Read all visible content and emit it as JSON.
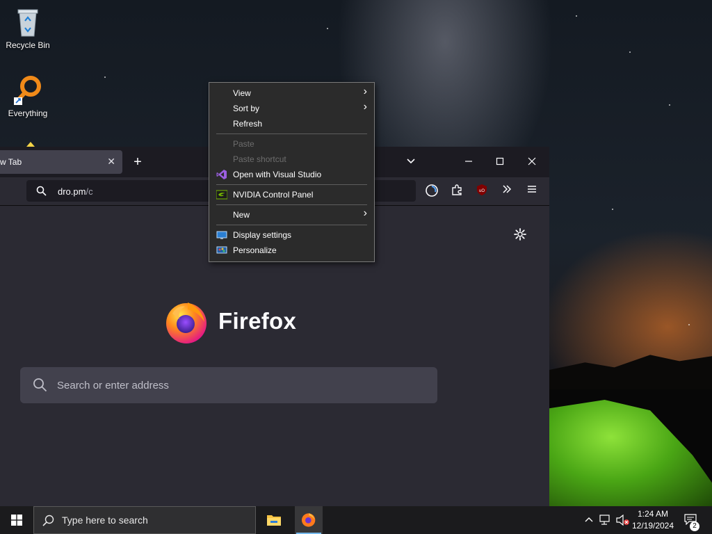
{
  "desktop": {
    "icons": [
      {
        "label": "Recycle Bin",
        "icon": "recycle-bin-icon"
      },
      {
        "label": "Everything",
        "icon": "everything-search-icon"
      }
    ]
  },
  "firefox": {
    "tab_title": "w Tab",
    "url_main": "dro.pm",
    "url_dim": "/c",
    "brand_name": "Firefox",
    "search_placeholder": "Search or enter address"
  },
  "context_menu": {
    "items": [
      {
        "label": "View",
        "submenu": true,
        "enabled": true
      },
      {
        "label": "Sort by",
        "submenu": true,
        "enabled": true
      },
      {
        "label": "Refresh",
        "enabled": true
      },
      {
        "label": "Paste",
        "enabled": false
      },
      {
        "label": "Paste shortcut",
        "enabled": false
      },
      {
        "label": "Open with Visual Studio",
        "enabled": true,
        "icon": "visual-studio-icon"
      },
      {
        "label": "NVIDIA Control Panel",
        "enabled": true,
        "icon": "nvidia-icon"
      },
      {
        "label": "New",
        "submenu": true,
        "enabled": true
      },
      {
        "label": "Display settings",
        "enabled": true,
        "icon": "display-settings-icon"
      },
      {
        "label": "Personalize",
        "enabled": true,
        "icon": "personalize-icon"
      }
    ]
  },
  "taskbar": {
    "search_placeholder": "Type here to search",
    "apps": [
      {
        "name": "File Explorer",
        "icon": "file-explorer-icon"
      },
      {
        "name": "Firefox",
        "icon": "firefox-icon",
        "active": true
      }
    ],
    "time": "1:24 AM",
    "date": "12/19/2024",
    "notification_count": "2"
  },
  "colors": {
    "accent": "#76b9ed",
    "tent_green": "#6cc325",
    "menu_bg": "#2b2b2b"
  }
}
